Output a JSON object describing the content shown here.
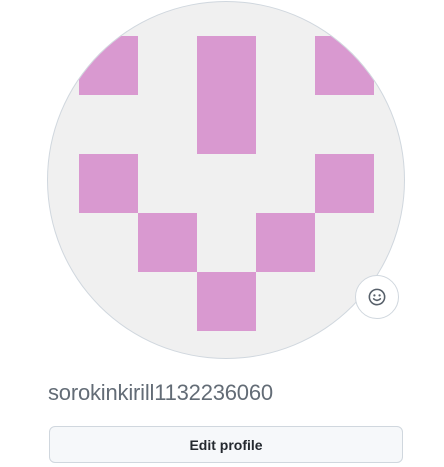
{
  "profile": {
    "username": "sorokinkirill1132236060",
    "edit_profile_label": "Edit profile",
    "status_icon": "smiley-icon"
  },
  "identicon": {
    "color": "#d999d0",
    "background": "#f0f0f0",
    "grid": [
      [
        1,
        0,
        1,
        0,
        1
      ],
      [
        0,
        0,
        1,
        0,
        0
      ],
      [
        1,
        0,
        0,
        0,
        1
      ],
      [
        0,
        1,
        0,
        1,
        0
      ],
      [
        0,
        0,
        1,
        0,
        0
      ]
    ]
  }
}
